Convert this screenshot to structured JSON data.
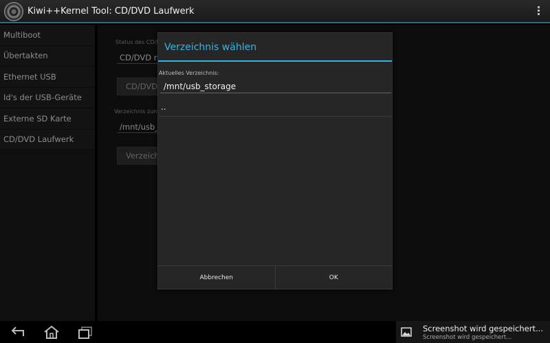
{
  "app": {
    "title": "Kiwi++Kernel Tool: CD/DVD Laufwerk"
  },
  "sidebar": {
    "items": [
      {
        "label": "Multiboot"
      },
      {
        "label": "Übertakten"
      },
      {
        "label": "Ethernet USB"
      },
      {
        "label": "Id's der USB-Geräte"
      },
      {
        "label": "Externe SD Karte"
      },
      {
        "label": "CD/DVD Laufwerk"
      }
    ]
  },
  "main": {
    "status_label": "Status des CD/D",
    "status_value": "CD/DVD ni",
    "status_button": "CD/DVD r",
    "dir_label": "Verzeichnis zum",
    "dir_value": "/mnt/usb_",
    "dir_button": "Verzeichnis"
  },
  "dialog": {
    "title": "Verzeichnis wählen",
    "current_dir_label": "Aktuelles Verzeichnis:",
    "current_dir_value": "/mnt/usb_storage",
    "list_items": [
      ".."
    ],
    "cancel_label": "Abbrechen",
    "ok_label": "OK"
  },
  "notification": {
    "title": "Screenshot wird gespeichert...",
    "subtitle": "Screenshot wird gespeichert..."
  },
  "icons": {
    "app": "app-logo-icon",
    "overflow": "overflow-menu-icon",
    "back": "back-icon",
    "home": "home-icon",
    "recent": "recent-apps-icon",
    "screenshot": "image-icon"
  },
  "colors": {
    "accent": "#33b5e5",
    "dialog_bg": "#262626"
  }
}
